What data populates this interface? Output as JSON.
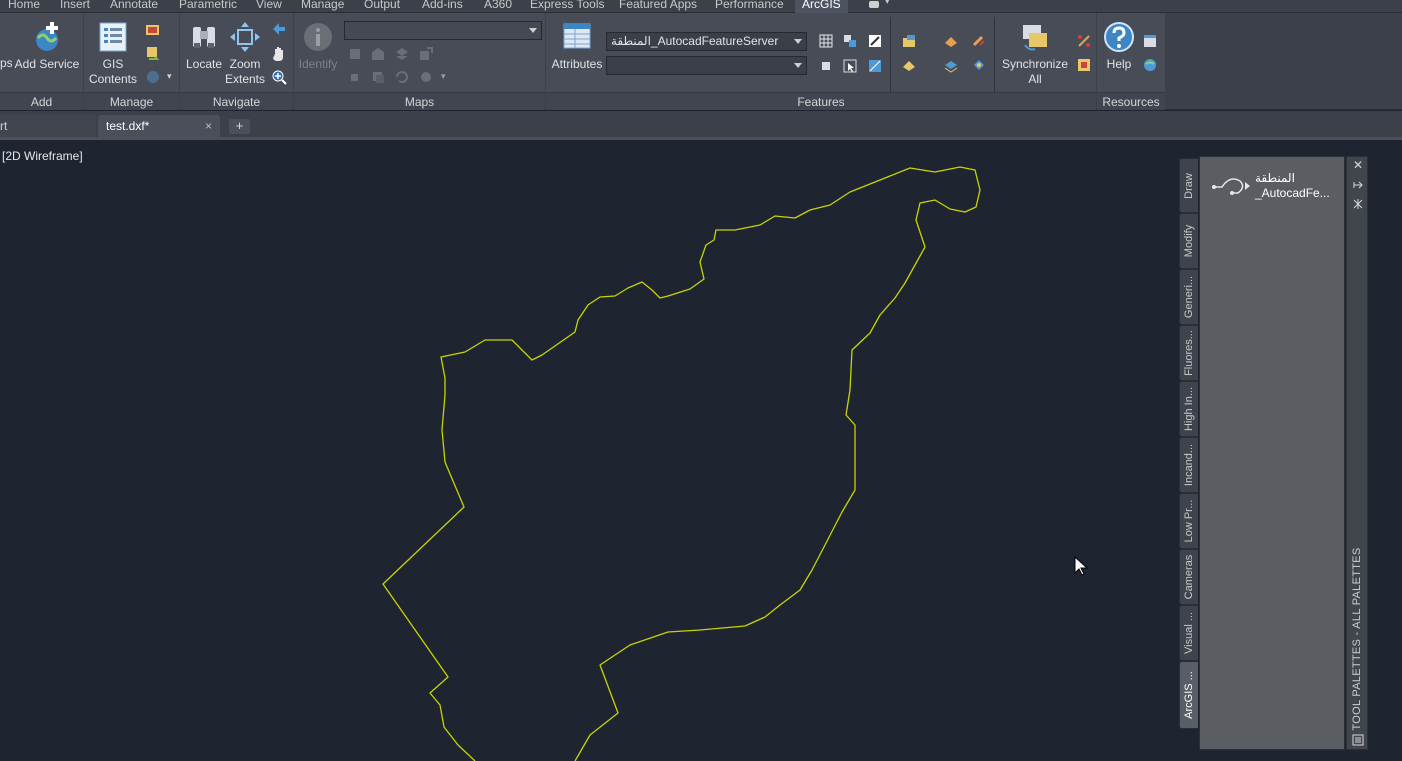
{
  "menu": {
    "tabs": [
      "Home",
      "Insert",
      "Annotate",
      "Parametric",
      "View",
      "Manage",
      "Output",
      "Add-ins",
      "A360",
      "Express Tools",
      "Featured Apps",
      "Performance",
      "ArcGIS"
    ],
    "active": "ArcGIS"
  },
  "ribbon": {
    "add": {
      "title": "Add",
      "partial_label": "ps",
      "add_service": "Add Service"
    },
    "manage": {
      "title": "Manage",
      "gis_contents_1": "GIS",
      "gis_contents_2": "Contents"
    },
    "navigate": {
      "title": "Navigate",
      "locate": "Locate",
      "zoom_1": "Zoom",
      "zoom_2": "Extents"
    },
    "maps": {
      "title": "Maps",
      "identify": "Identify",
      "combo_value": ""
    },
    "features": {
      "title": "Features",
      "attributes": "Attributes",
      "layer_combo": "المنطقة_AutocadFeatureServer",
      "subtype_combo": "",
      "sync_1": "Synchronize",
      "sync_2": "All"
    },
    "resources": {
      "title": "Resources",
      "help": "Help"
    }
  },
  "doc_tabs": {
    "prev_tab": "rt",
    "active_tab": "test.dxf*",
    "close_glyph": "×",
    "new_glyph": "+"
  },
  "viewport": {
    "label": "[2D Wireframe]",
    "boundary_color": "#c8d400"
  },
  "palette": {
    "tabs": [
      "Draw",
      "Modify",
      "Generi...",
      "Fluores...",
      "High In...",
      "Incand...",
      "Low Pr...",
      "Cameras",
      "Visual ...",
      "ArcGIS ..."
    ],
    "active_tab": "ArcGIS ...",
    "item_line1": "المنطقة",
    "item_line2": "_AutocadFe...",
    "title": "TOOL PALETTES - ALL PALETTES",
    "close_glyph": "✕"
  }
}
